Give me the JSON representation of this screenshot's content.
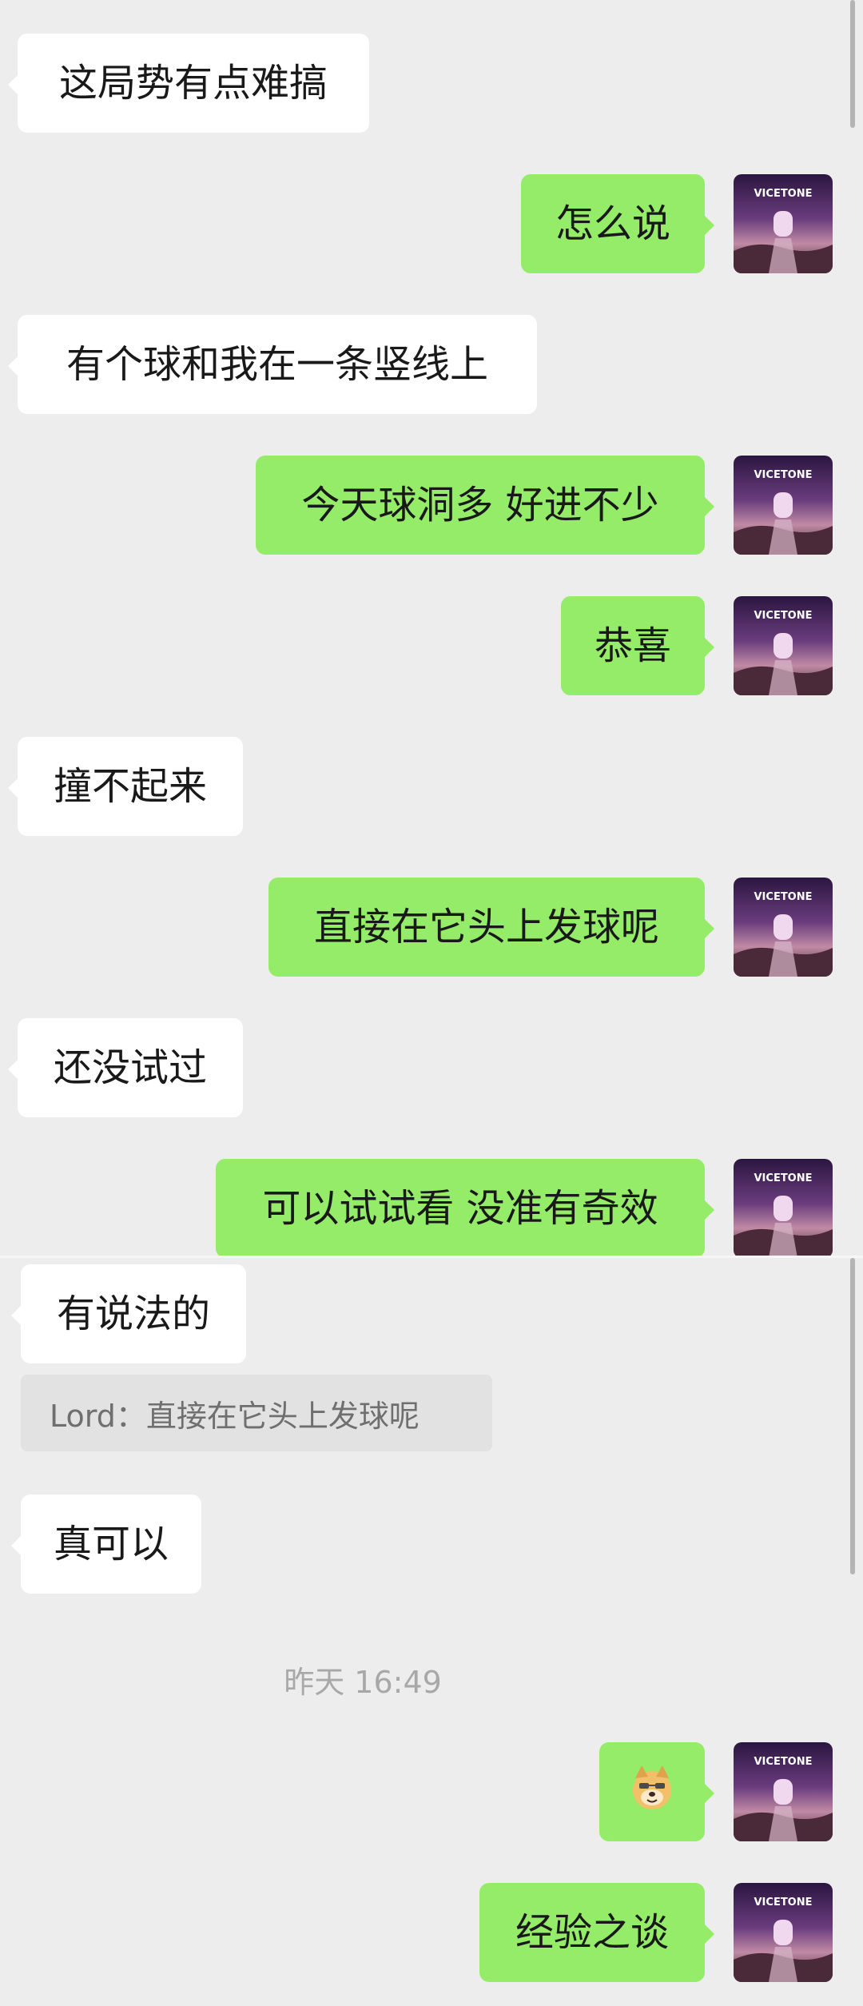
{
  "messages": [
    {
      "side": "left",
      "text": "这局势有点难搞"
    },
    {
      "side": "right",
      "text": "怎么说"
    },
    {
      "side": "left",
      "text": "有个球和我在一条竖线上"
    },
    {
      "side": "right",
      "text": "今天球洞多 好进不少"
    },
    {
      "side": "right",
      "text": "恭喜"
    },
    {
      "side": "left",
      "text": "撞不起来"
    },
    {
      "side": "right",
      "text": "直接在它头上发球呢"
    },
    {
      "side": "left",
      "text": "还没试过"
    },
    {
      "side": "right",
      "text": "可以试试看 没准有奇效"
    },
    {
      "side": "left",
      "text": "有说法的"
    },
    {
      "side": "left",
      "text": "真可以"
    },
    {
      "side": "right",
      "text": "经验之谈"
    }
  ],
  "quote": "Lord：直接在它头上发球呢",
  "timestamp": "昨天 16:49",
  "avatar_brand": "VICETONE",
  "colors": {
    "background": "#ededed",
    "outgoing": "#95ec69",
    "incoming": "#ffffff"
  }
}
